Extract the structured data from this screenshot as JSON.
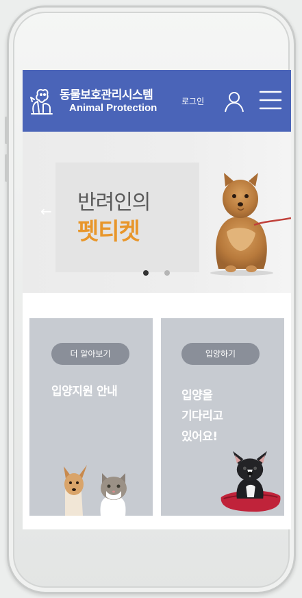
{
  "header": {
    "brand_kr": "동물보호관리시스템",
    "brand_en": "Animal Protection",
    "login_label": "로그인",
    "icons": {
      "logo": "pets-logo-icon",
      "user": "user-icon",
      "menu": "hamburger-menu-icon"
    },
    "color": "#4a64b8"
  },
  "hero": {
    "line1": "반려인의",
    "line2": "펫티켓",
    "prev_icon": "arrow-left-icon",
    "slides_total": 2,
    "slide_active": 1,
    "accent_color": "#e8962a"
  },
  "cards": [
    {
      "button_label": "더 알아보기",
      "title": "입양지원 안내"
    },
    {
      "button_label": "입양하기",
      "title_lines": [
        "입양을",
        "기다리고",
        "있어요!"
      ]
    }
  ]
}
